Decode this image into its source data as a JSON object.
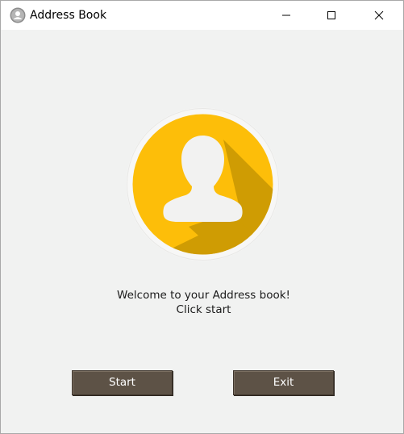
{
  "window": {
    "title": "Address Book",
    "icon": "user-avatar-icon",
    "controls": [
      "minimize-icon",
      "maximize-icon",
      "close-icon"
    ]
  },
  "main": {
    "avatar_icon": "user-silhouette-icon",
    "welcome_line1": "Welcome to your Address book!",
    "welcome_line2": "Click start"
  },
  "buttons": {
    "start_label": "Start",
    "exit_label": "Exit"
  },
  "colors": {
    "avatar_circle": "#fdbe09",
    "avatar_shadow": "#cf9c03",
    "button_bg": "#5d5246",
    "window_bg": "#f1f2f1"
  }
}
